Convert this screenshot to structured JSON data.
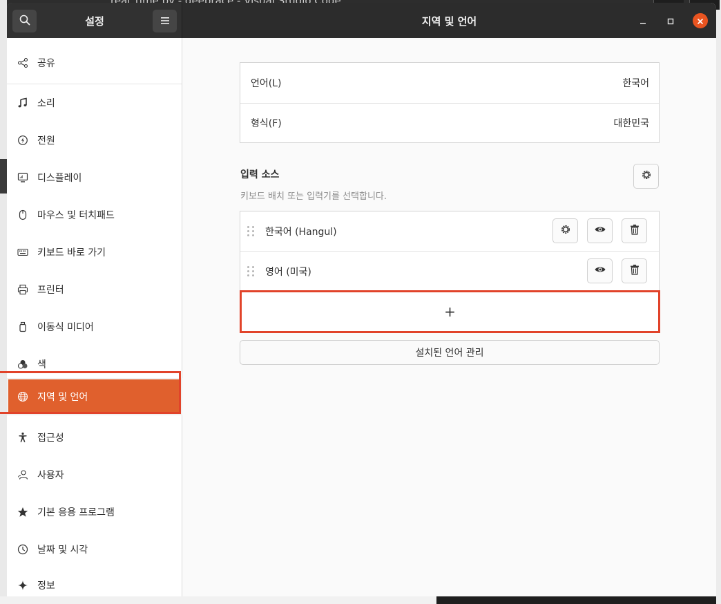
{
  "background": {
    "window_title_fragment": "real_time by - deeprace - Visual Studio Code"
  },
  "header": {
    "sidebar_title": "설정",
    "panel_title": "지역 및 언어",
    "search_icon": "search-icon",
    "menu_icon": "hamburger-menu-icon",
    "close_color": "#e95420"
  },
  "sidebar": {
    "accent": "#e0602d",
    "items": [
      {
        "label": "공유",
        "icon": "share-icon"
      },
      {
        "label": "소리",
        "icon": "music-note-icon"
      },
      {
        "label": "전원",
        "icon": "power-icon"
      },
      {
        "label": "디스플레이",
        "icon": "display-icon"
      },
      {
        "label": "마우스 및 터치패드",
        "icon": "mouse-icon"
      },
      {
        "label": "키보드 바로 가기",
        "icon": "keyboard-icon"
      },
      {
        "label": "프린터",
        "icon": "printer-icon"
      },
      {
        "label": "이동식 미디어",
        "icon": "removable-media-icon"
      },
      {
        "label": "색",
        "icon": "color-icon"
      },
      {
        "label": "지역 및 언어",
        "icon": "globe-icon",
        "active": true
      },
      {
        "label": "접근성",
        "icon": "accessibility-icon"
      },
      {
        "label": "사용자",
        "icon": "users-icon"
      },
      {
        "label": "기본 응용 프로그램",
        "icon": "star-icon"
      },
      {
        "label": "날짜 및 시각",
        "icon": "clock-icon"
      },
      {
        "label": "정보",
        "icon": "sparkle-icon"
      }
    ]
  },
  "main": {
    "language": {
      "label": "언어(L)",
      "value": "한국어"
    },
    "formats": {
      "label": "형식(F)",
      "value": "대한민국"
    },
    "input_sources": {
      "title": "입력 소스",
      "subtitle": "키보드 배치 또는 입력기를 선택합니다.",
      "sources": [
        {
          "name": "한국어 (Hangul)",
          "has_settings": true
        },
        {
          "name": "영어 (미국)",
          "has_settings": false
        }
      ],
      "add_label": "+"
    },
    "manage_button": "설치된 언어 관리"
  }
}
